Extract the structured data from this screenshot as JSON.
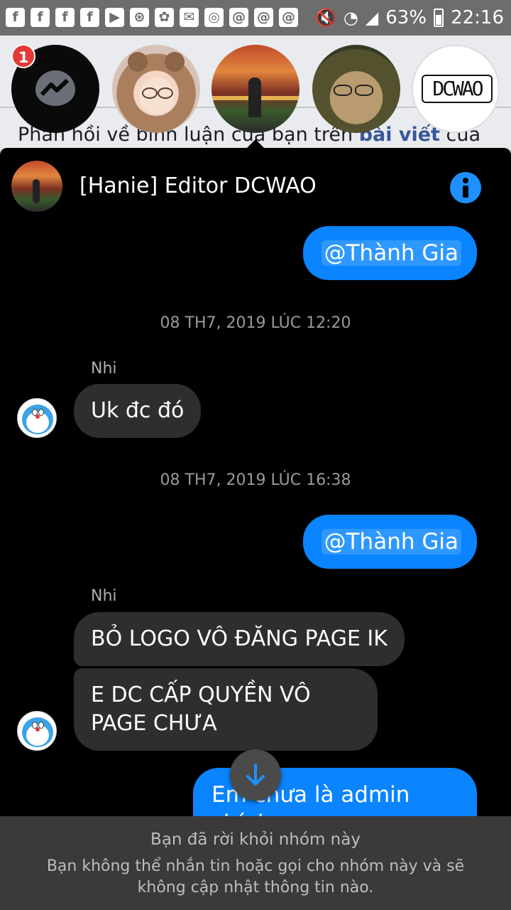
{
  "status_bar": {
    "notification_icons": [
      "f",
      "f",
      "f",
      "f",
      "▶",
      "⊛",
      "✿",
      "✉",
      "◎",
      "@",
      "@",
      "@"
    ],
    "battery": "63%",
    "time": "22:16"
  },
  "background_page": {
    "title_fragment": "hả",
    "text_before": "Phản hồi về bình luận của bạn trên ",
    "text_link": "bài viết",
    "text_after": " của"
  },
  "chat_heads": {
    "unread_badge": "1",
    "dcwao_logo": "DCWAO"
  },
  "chat": {
    "title": "[Hanie] Editor DCWAO",
    "messages": {
      "out_1": "@Thành Gia",
      "ts_1": "08 TH7, 2019 LÚC 12:20",
      "sender_1": "Nhi",
      "in_1": "Uk đc đó",
      "ts_2": "08 TH7, 2019 LÚC 16:38",
      "out_2": "@Thành Gia",
      "sender_2": "Nhi",
      "in_2": "BỎ LOGO VÔ ĐĂNG PAGE IK",
      "in_3": "E DC CẤP QUYỀN VÔ PAGE CHƯA",
      "out_3": "Em chưa là admin chính"
    },
    "footer": {
      "line1": "Bạn đã rời khỏi nhóm này",
      "line2": "Bạn không thể nhắn tin hoặc gọi cho nhóm này và sẽ không cập nhật thông tin nào."
    }
  },
  "colors": {
    "accent": "#0a84ff",
    "incoming_bubble": "#2e2e2e",
    "panel_bg": "#000000"
  }
}
